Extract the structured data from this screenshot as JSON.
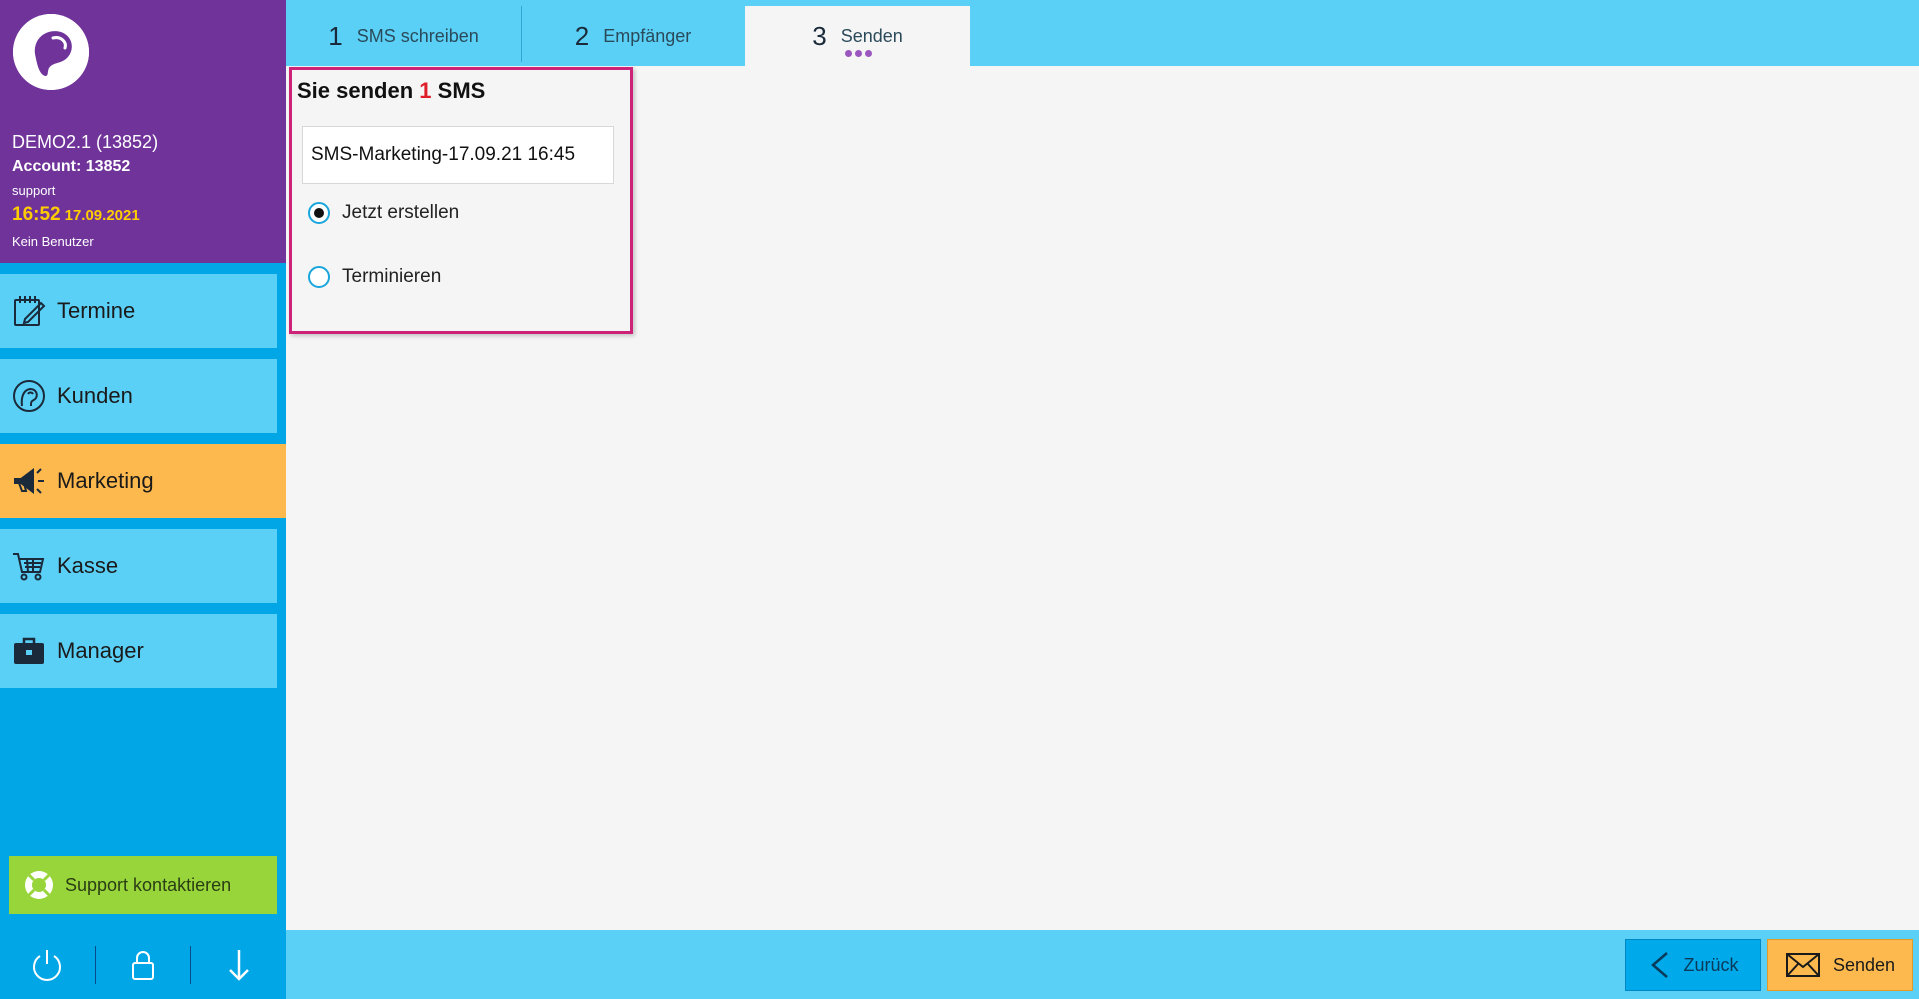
{
  "sidebar": {
    "account": {
      "name": "DEMO2.1 (13852)",
      "account_line": "Account: 13852",
      "user": "support",
      "time": "16:52",
      "date": "17.09.2021",
      "no_user": "Kein Benutzer"
    },
    "items": [
      {
        "label": "Termine",
        "icon": "calendar-edit-icon"
      },
      {
        "label": "Kunden",
        "icon": "customer-head-icon"
      },
      {
        "label": "Marketing",
        "icon": "megaphone-icon",
        "active": true
      },
      {
        "label": "Kasse",
        "icon": "cart-icon"
      },
      {
        "label": "Manager",
        "icon": "briefcase-icon"
      }
    ],
    "support_label": "Support kontaktieren",
    "bottom_icons": [
      "power-icon",
      "lock-icon",
      "arrow-down-icon"
    ]
  },
  "tabs": [
    {
      "num": "1",
      "label": "SMS schreiben"
    },
    {
      "num": "2",
      "label": "Empfänger"
    },
    {
      "num": "3",
      "label": "Senden",
      "selected": true
    }
  ],
  "panel": {
    "title_prefix": "Sie senden",
    "count": "1",
    "title_suffix": "SMS",
    "name_value": "SMS-Marketing-17.09.21 16:45",
    "options": [
      {
        "label": "Jetzt erstellen",
        "checked": true
      },
      {
        "label": "Terminieren",
        "checked": false
      }
    ]
  },
  "footer": {
    "back_label": "Zurück",
    "send_label": "Senden"
  },
  "colors": {
    "sidebar_top": "#70339a",
    "sidebar_bg": "#00a6e6",
    "nav_item": "#5ad0f7",
    "active": "#fdb94d",
    "support": "#97d53a",
    "highlight_border": "#cc2278",
    "count": "#e01e2a"
  }
}
